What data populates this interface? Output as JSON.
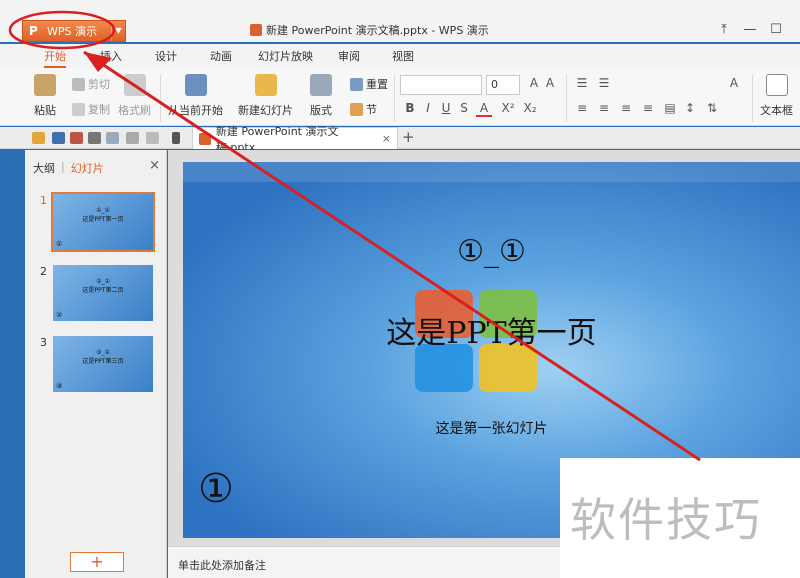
{
  "titlebar": {
    "app_button_label": "WPS 演示",
    "document_title": "新建 PowerPoint 演示文稿.pptx - WPS 演示"
  },
  "ribbon_tabs": [
    "开始",
    "插入",
    "设计",
    "动画",
    "幻灯片放映",
    "审阅",
    "视图"
  ],
  "ribbon": {
    "paste": "粘贴",
    "cut": "剪切",
    "copy": "复制",
    "format_painter": "格式刷",
    "from_current": "从当前开始",
    "new_slide": "新建幻灯片",
    "layout": "版式",
    "reset": "重置",
    "section": "节",
    "font_size": "0",
    "textbox": "文本框"
  },
  "document_tab": {
    "label": "新建 PowerPoint 演示文稿.pptx"
  },
  "left_panel": {
    "tab_outline": "大纲",
    "tab_slides": "幻灯片",
    "thumbnails": [
      {
        "num": "1",
        "title": "①_①",
        "sub": "这是PPT第一页",
        "corner": "①"
      },
      {
        "num": "2",
        "title": "②_①",
        "sub": "这是PPT第二页",
        "corner": "②"
      },
      {
        "num": "3",
        "title": "③_①",
        "sub": "这是PPT第三页",
        "corner": "③"
      }
    ],
    "add_slide": "+"
  },
  "slide": {
    "title": "①_①",
    "heading": "这是PPT第一页",
    "subtitle": "这是第一张幻灯片",
    "corner_number": "①"
  },
  "notes_placeholder": "单击此处添加备注",
  "watermark": "软件技巧",
  "colors": {
    "accent": "#e05f27",
    "annotation": "#d92020"
  }
}
